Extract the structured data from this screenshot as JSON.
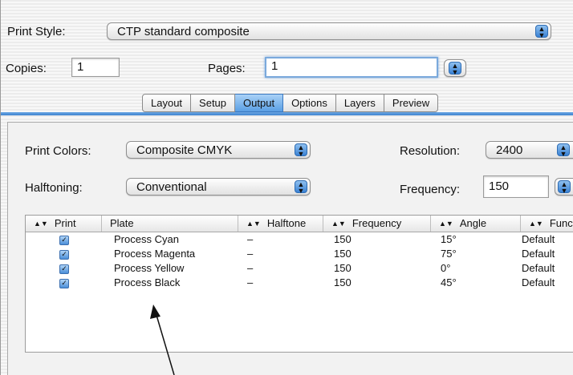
{
  "print_style": {
    "label": "Print Style:",
    "value": "CTP standard composite"
  },
  "copies": {
    "label": "Copies:",
    "value": "1"
  },
  "pages": {
    "label": "Pages:",
    "value": "1"
  },
  "tabs": [
    {
      "label": "Layout"
    },
    {
      "label": "Setup"
    },
    {
      "label": "Output",
      "active": true
    },
    {
      "label": "Options"
    },
    {
      "label": "Layers"
    },
    {
      "label": "Preview"
    }
  ],
  "output": {
    "print_colors": {
      "label": "Print Colors:",
      "value": "Composite CMYK"
    },
    "halftoning": {
      "label": "Halftoning:",
      "value": "Conventional"
    },
    "resolution": {
      "label": "Resolution:",
      "value": "2400"
    },
    "frequency": {
      "label": "Frequency:",
      "value": "150"
    }
  },
  "plates_table": {
    "columns": [
      "Print",
      "Plate",
      "Halftone",
      "Frequency",
      "Angle",
      "Funct"
    ],
    "rows": [
      {
        "plate": "Process Cyan",
        "halftone": "–",
        "frequency": "150",
        "angle": "15°",
        "function": "Default"
      },
      {
        "plate": "Process Magenta",
        "halftone": "–",
        "frequency": "150",
        "angle": "75°",
        "function": "Default"
      },
      {
        "plate": "Process Yellow",
        "halftone": "–",
        "frequency": "150",
        "angle": "0°",
        "function": "Default"
      },
      {
        "plate": "Process Black",
        "halftone": "–",
        "frequency": "150",
        "angle": "45°",
        "function": "Default"
      }
    ]
  },
  "icons": {
    "popup_arrows": "up-down-arrows-icon",
    "checkbox": "checkmark-icon",
    "sort": "sort-arrows-icon",
    "pointer": "callout-arrow"
  },
  "colors": {
    "accent": "#3f84d0",
    "tab_active": "#5a9fe4"
  }
}
